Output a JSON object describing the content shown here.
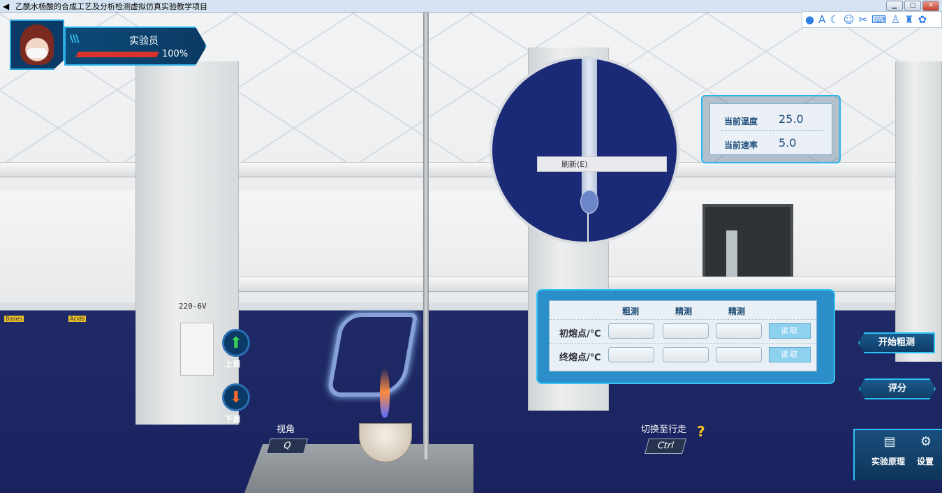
{
  "window": {
    "title": "乙酰水杨酸的合成工艺及分析检测虚拟仿真实验教学项目",
    "min": "▁",
    "max": "▢",
    "close": "✕"
  },
  "ime_toolbar": [
    "profile-icon",
    "A",
    "moon-icon",
    "emoji-icon",
    "scissors-icon",
    "keyboard-icon",
    "person-icon",
    "shirt-icon",
    "gear-icon"
  ],
  "player": {
    "role": "实验员",
    "health": "100%",
    "health_value": 1.0
  },
  "scene": {
    "socket_voltage": "220-6V",
    "bases_tag": "Bases",
    "acids_tag": "Acids"
  },
  "magnifier": {
    "refresh_label": "刷新(E)"
  },
  "status": {
    "temp_label": "当前温度",
    "temp_value": "25.0",
    "rate_label": "当前速率",
    "rate_value": "5.0"
  },
  "measure": {
    "headers": [
      "粗测",
      "精测",
      "精测"
    ],
    "rows": [
      {
        "label": "初熔点/℃",
        "read": "读取"
      },
      {
        "label": "终熔点/℃",
        "read": "读取"
      }
    ]
  },
  "controls": {
    "up_label": "上调",
    "down_label": "下调",
    "view_title": "视角",
    "view_key": "Q",
    "walk_title": "切换至行走",
    "walk_key": "Ctrl",
    "help": "?"
  },
  "buttons": {
    "start_coarse": "开始粗测",
    "score": "评分",
    "principle": "实验原理",
    "settings": "设置"
  },
  "colors": {
    "hud_blue": "#0e3d68",
    "hud_border": "#2cc2f4",
    "floor": "#1f2a66",
    "health_red": "#d9332c"
  }
}
